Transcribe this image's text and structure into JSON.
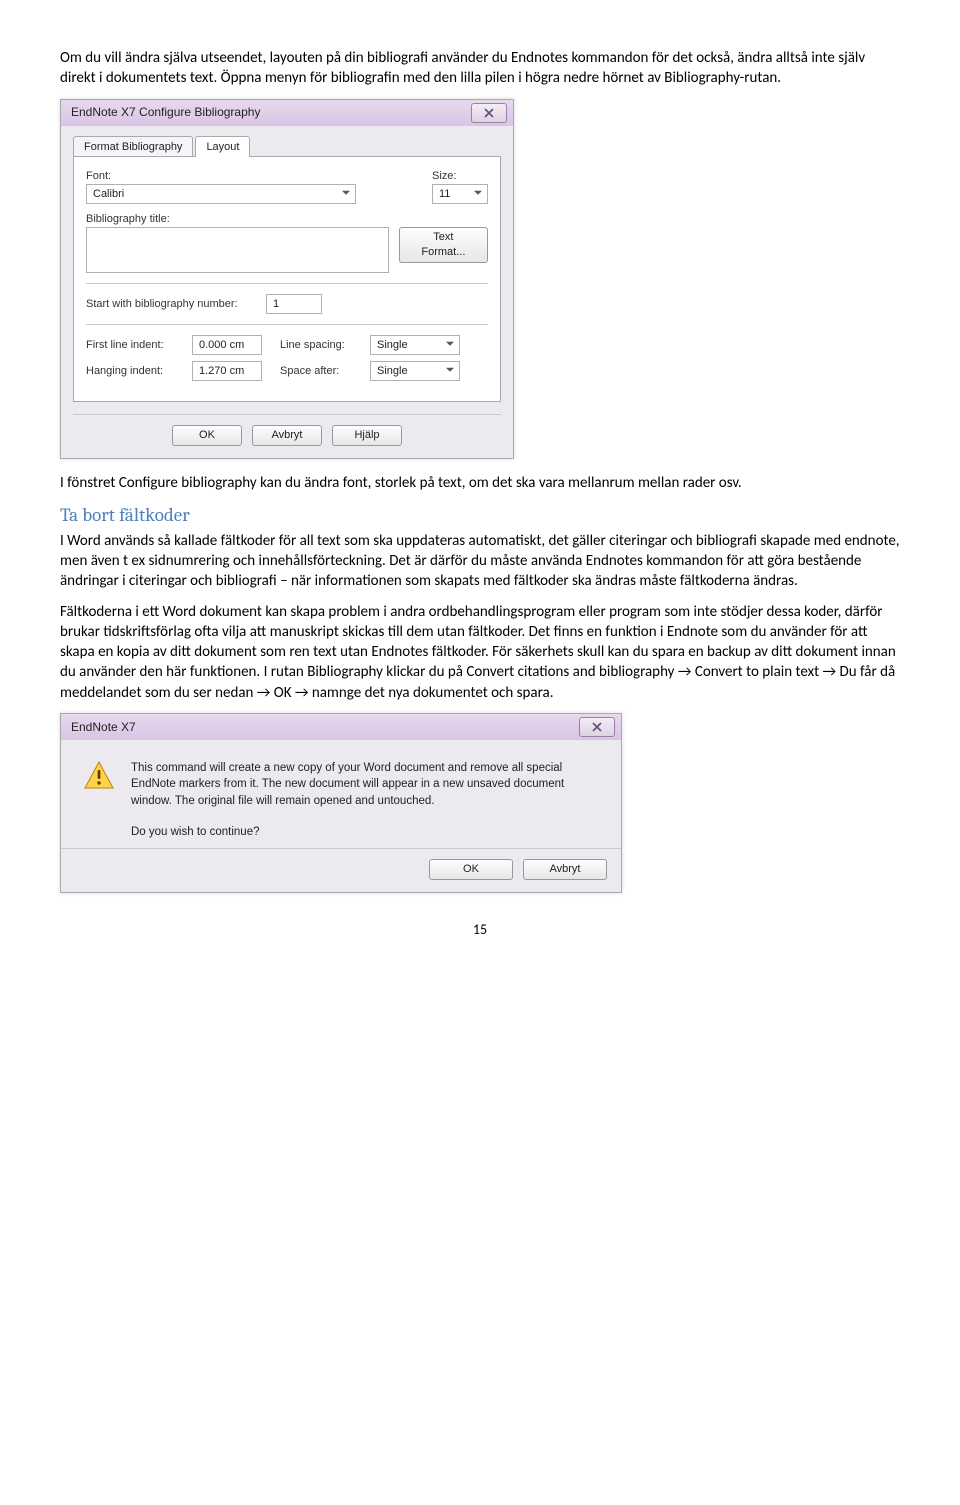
{
  "para1": "Om du vill ändra själva utseendet, layouten på din bibliografi använder du Endnotes kommandon för det också, ändra alltså inte själv direkt i dokumentets text. Öppna menyn för bibliografin med den lilla pilen i högra nedre hörnet av Bibliography-rutan.",
  "config": {
    "title": "EndNote X7 Configure Bibliography",
    "tab_format": "Format Bibliography",
    "tab_layout": "Layout",
    "lbl_font": "Font:",
    "val_font": "Calibri",
    "lbl_size": "Size:",
    "val_size": "11",
    "lbl_bibtitle": "Bibliography title:",
    "btn_textformat": "Text Format...",
    "lbl_startwith": "Start with bibliography number:",
    "val_startwith": "1",
    "lbl_firstline": "First line indent:",
    "val_firstline": "0.000 cm",
    "lbl_linesp": "Line spacing:",
    "val_linesp": "Single",
    "lbl_hanging": "Hanging indent:",
    "val_hanging": "1.270 cm",
    "lbl_spaceafter": "Space after:",
    "val_spaceafter": "Single",
    "btn_ok": "OK",
    "btn_cancel": "Avbryt",
    "btn_help": "Hjälp"
  },
  "para2": "I fönstret Configure bibliography kan du ändra font, storlek på text, om det ska vara mellanrum mellan rader osv.",
  "heading": "Ta bort fältkoder",
  "para3": "I Word används så kallade fältkoder för all text som ska uppdateras automatiskt, det gäller citeringar och bibliografi skapade med endnote, men även t ex sidnumrering och innehållsförteckning. Det är därför du måste använda Endnotes kommandon för att göra bestående ändringar i citeringar och bibliografi – när informationen som skapats med fältkoder ska ändras måste fältkoderna ändras.",
  "para4": "Fältkoderna i ett Word dokument kan skapa problem i andra ordbehandlingsprogram eller program som inte stödjer dessa koder, därför brukar tidskriftsförlag ofta vilja att manuskript skickas till dem utan fältkoder. Det finns en funktion i Endnote som du använder för att skapa en kopia av ditt dokument som ren text utan Endnotes fältkoder. För säkerhets skull kan du spara en backup av ditt dokument innan du använder den här funktionen. I rutan Bibliography klickar du på Convert citations and bibliography → Convert to plain text → Du får då meddelandet som du ser nedan → OK → namnge det nya dokumentet och spara.",
  "alert": {
    "title": "EndNote X7",
    "msg": "This command will create a new copy of your Word document and remove all special EndNote markers from it. The new document will appear in a new unsaved document window. The original file will remain opened and untouched.",
    "question": "Do you wish to continue?",
    "btn_ok": "OK",
    "btn_cancel": "Avbryt"
  },
  "page_number": "15"
}
